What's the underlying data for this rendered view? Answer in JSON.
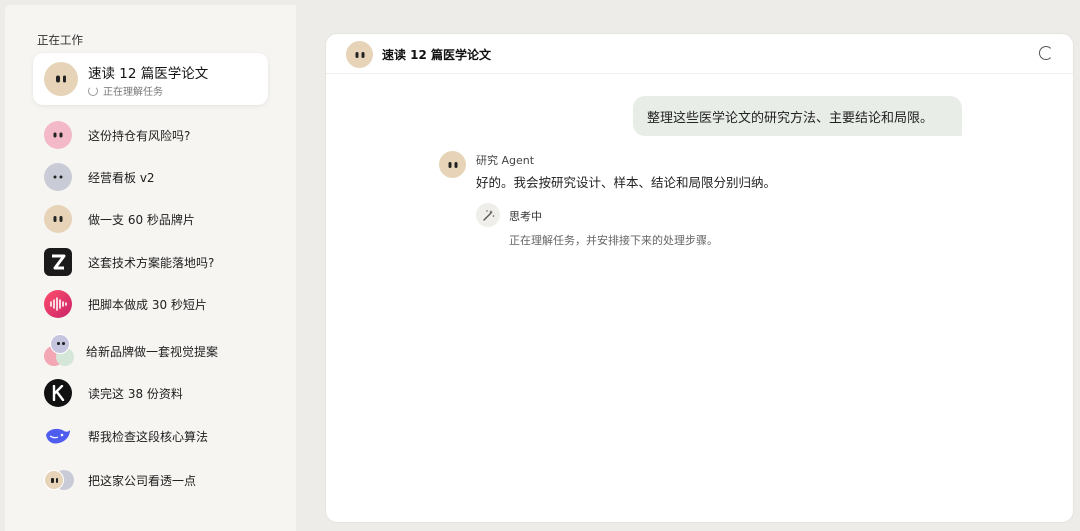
{
  "sidebar": {
    "section_title": "正在工作",
    "active": {
      "title": "速读 12 篇医学论文",
      "status": "正在理解任务"
    },
    "items": [
      {
        "label": "这份持仓有风险吗?",
        "icon": "pink-face-avatar"
      },
      {
        "label": "经营看板 v2",
        "icon": "gray-face-avatar"
      },
      {
        "label": "做一支 60 秒品牌片",
        "icon": "beige-face-avatar"
      },
      {
        "label": "这套技术方案能落地吗?",
        "icon": "z-logo"
      },
      {
        "label": "把脚本做成 30 秒短片",
        "icon": "sound-wave-logo"
      },
      {
        "label": "给新品牌做一套视觉提案",
        "icon": "group-avatars"
      },
      {
        "label": "读完这 38 份资料",
        "icon": "k-logo"
      },
      {
        "label": "帮我检查这段核心算法",
        "icon": "whale-logo"
      },
      {
        "label": "把这家公司看透一点",
        "icon": "pair-avatars"
      }
    ]
  },
  "main": {
    "header_title": "速读 12 篇医学论文",
    "user_message": "整理这些医学论文的研究方法、主要结论和局限。",
    "agent": {
      "name": "研究 Agent",
      "message": "好的。我会按研究设计、样本、结论和局限分别归纳。",
      "thinking_label": "思考中",
      "thinking_text": "正在理解任务，并安排接下来的处理步骤。"
    }
  },
  "colors": {
    "beige_avatar": "#e6d3b8",
    "pink_avatar": "#f4b9c8",
    "gray_avatar": "#c9ccd6",
    "user_bubble": "#e8ede8",
    "page_background": "#edece8"
  }
}
